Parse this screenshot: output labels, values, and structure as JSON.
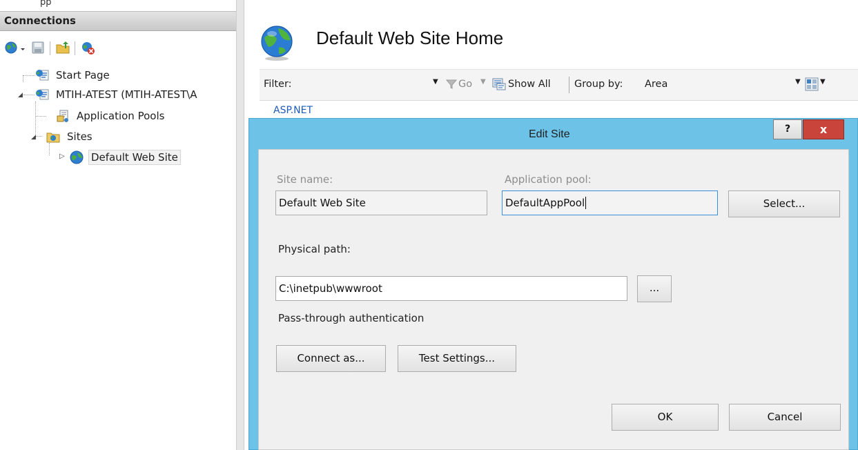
{
  "window": {
    "partial_title": "pp"
  },
  "connections": {
    "header": "Connections",
    "tree": [
      {
        "label": "Start Page"
      },
      {
        "label": "MTIH-ATEST (MTIH-ATEST\\A"
      },
      {
        "label": "Application Pools"
      },
      {
        "label": "Sites"
      },
      {
        "label": "Default Web Site"
      }
    ]
  },
  "main": {
    "title": "Default Web Site Home",
    "filter_bar": {
      "filter_label": "Filter:",
      "go_label": "Go",
      "show_all_label": "Show All",
      "group_by_label": "Group by:",
      "group_by_value": "Area"
    },
    "section_heading": "ASP.NET"
  },
  "dialog": {
    "title": "Edit Site",
    "help_label": "?",
    "close_label": "x",
    "site_name_label": "Site name:",
    "site_name_value": "Default Web Site",
    "app_pool_label": "Application pool:",
    "app_pool_value": "DefaultAppPool",
    "select_button": "Select...",
    "physical_path_label": "Physical path:",
    "physical_path_value": "C:\\inetpub\\wwwroot",
    "browse_button": "...",
    "pass_through_label": "Pass-through authentication",
    "connect_as_button": "Connect as...",
    "test_settings_button": "Test Settings...",
    "ok_button": "OK",
    "cancel_button": "Cancel"
  },
  "colors": {
    "dialog_frame": "#6cc3e7",
    "close_button": "#c9443a",
    "link_blue": "#1e5bb8"
  }
}
